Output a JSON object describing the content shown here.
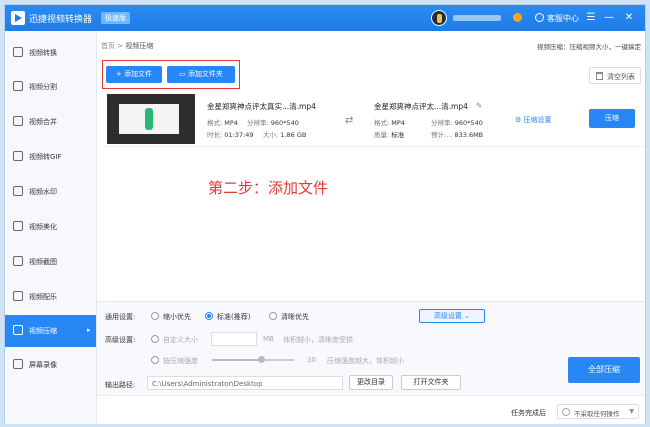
{
  "app": {
    "title": "迅捷视频转换器",
    "badge": "极速版"
  },
  "header": {
    "service": "客服中心",
    "menu_icon": "☰",
    "min_icon": "—",
    "close_icon": "✕"
  },
  "sidebar": {
    "items": [
      {
        "label": "视频转换"
      },
      {
        "label": "视频分割"
      },
      {
        "label": "视频合并"
      },
      {
        "label": "视频转GIF"
      },
      {
        "label": "视频水印"
      },
      {
        "label": "视频美化"
      },
      {
        "label": "视频截图"
      },
      {
        "label": "视频配乐"
      },
      {
        "label": "视频压缩",
        "active": true
      },
      {
        "label": "屏幕录像"
      }
    ]
  },
  "breadcrumb": {
    "home": "首页",
    "sep": ">",
    "current": "视频压缩"
  },
  "hint": "视频压缩：压缩视频大小，一键搞定",
  "toolbar": {
    "add_file": "+ 添加文件",
    "add_folder": "添加文件夹",
    "clear": "清空列表"
  },
  "task": {
    "src": {
      "name": "金星郑爽神点评太真实...清.mp4",
      "format_label": "格式:",
      "format": "MP4",
      "res_label": "分辨率:",
      "res": "960*540",
      "dur_label": "时长:",
      "dur": "01:37:49",
      "size_label": "大小:",
      "size": "1.86 GB"
    },
    "dst": {
      "name": "金星郑爽神点评太...清.mp4",
      "format_label": "格式:",
      "format": "MP4",
      "res_label": "分辨率:",
      "res": "960*540",
      "q_label": "质量:",
      "q": "标准",
      "est_label": "预计:...",
      "est": "833.6MB"
    },
    "settings": "压缩设置",
    "compress": "压缩"
  },
  "annotation": "第二步：添加文件",
  "settings": {
    "general_label": "通用设置:",
    "opt_small": "缩小优先",
    "opt_standard": "标准(推荐)",
    "opt_clear": "清晰优先",
    "adv_button": "高级设置",
    "adv_label": "高级设置:",
    "custom_size": "自定义大小",
    "mb": "MB",
    "custom_hint": "体积越小，清晰度受损",
    "by_ratio": "按压缩强度",
    "ratio_value": "30",
    "ratio_level": 0.6,
    "ratio_hint": "压缩强度越大，体积越小",
    "output_label": "输出路径:",
    "output_path": "C:\\Users\\Administrator\\Desktop",
    "change_dir": "更改目录",
    "open_folder": "打开文件夹",
    "compress_all": "全部压缩"
  },
  "status": {
    "after_label": "任务完成后",
    "after_value": "不采取任何操作"
  }
}
